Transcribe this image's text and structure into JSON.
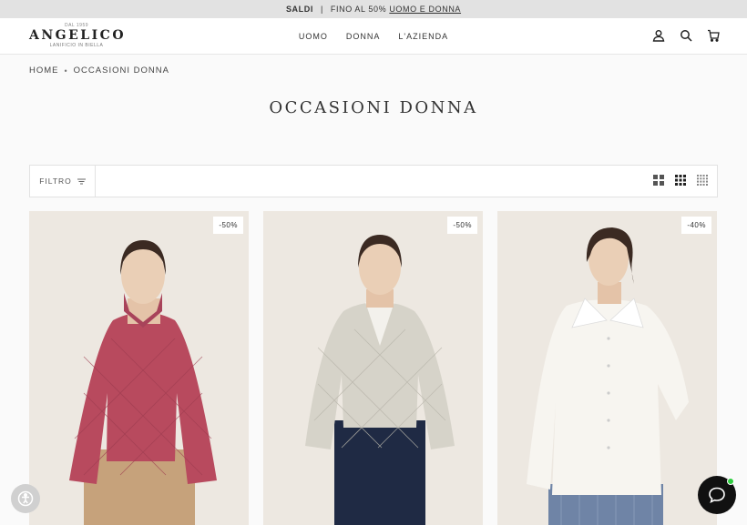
{
  "announcement": {
    "saldi": "SALDI",
    "separator": "|",
    "text": "FINO AL 50%",
    "link": "UOMO E DONNA"
  },
  "logo": {
    "since": "DAL 1959",
    "name": "ANGELICO",
    "subtitle": "LANIFICIO IN BIELLA"
  },
  "nav": {
    "items": [
      "UOMO",
      "DONNA",
      "L'AZIENDA"
    ]
  },
  "header_icons": [
    "account-icon",
    "search-icon",
    "cart-icon"
  ],
  "breadcrumb": {
    "home": "HOME",
    "separator": "•",
    "current": "OCCASIONI DONNA"
  },
  "page_title": "OCCASIONI DONNA",
  "toolbar": {
    "filter_label": "FILTRO",
    "view_icons": [
      "grid-large-icon",
      "grid-medium-icon",
      "grid-small-icon"
    ]
  },
  "products": [
    {
      "badge": "-50%",
      "garment_color": "#b84a5e"
    },
    {
      "badge": "-50%",
      "garment_color": "#d6d3c9"
    },
    {
      "badge": "-40%",
      "garment_color": "#f7f5f0"
    }
  ],
  "colors": {
    "announcement_bg": "#e2e2e2",
    "page_bg": "#fafafa",
    "chat_button": "#111111",
    "chat_online": "#2ecc40"
  }
}
